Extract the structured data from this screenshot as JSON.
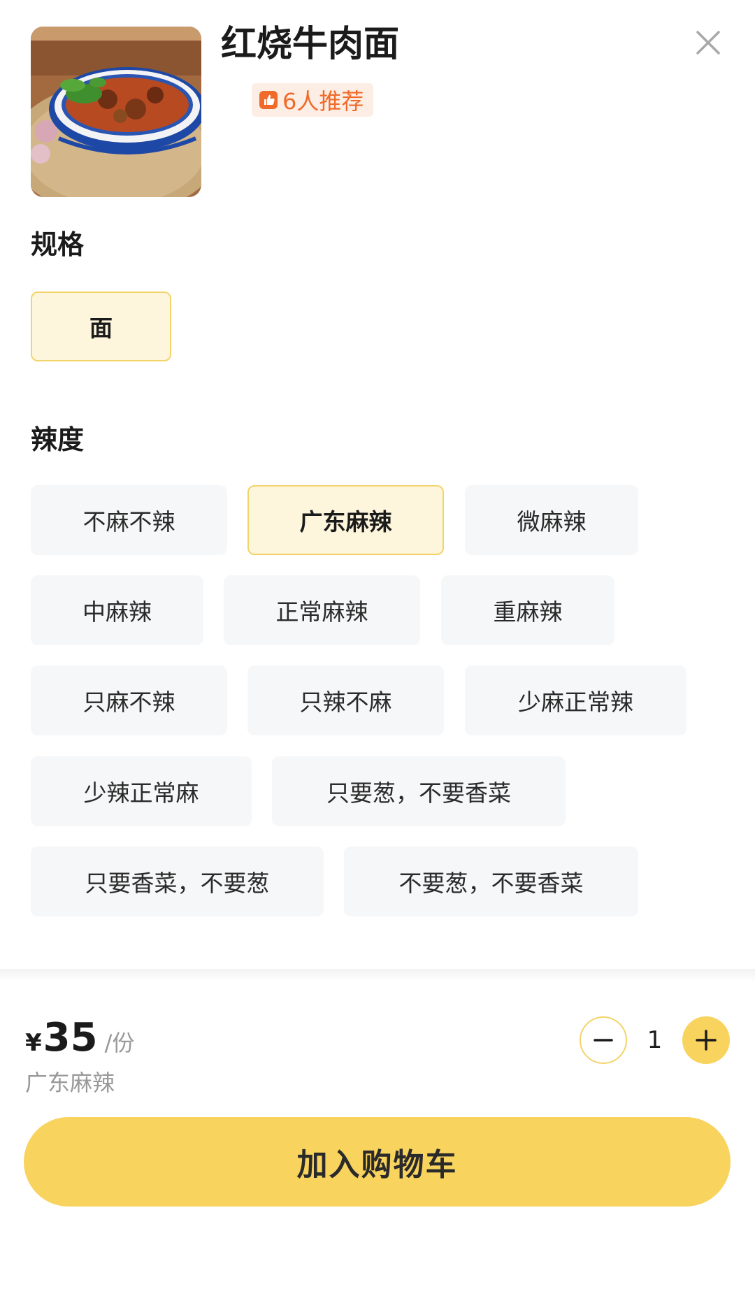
{
  "dish": {
    "title": "红烧牛肉面",
    "image_icon": "beef-noodle-bowl-photo",
    "recommend": {
      "icon": "thumbs-up-icon",
      "text": "6人推荐",
      "color": "#f06a2a"
    }
  },
  "close": {
    "icon": "close-icon"
  },
  "spec": {
    "title": "规格",
    "options": [
      {
        "label": "面",
        "selected": true
      }
    ]
  },
  "spiciness": {
    "title": "辣度",
    "options": [
      {
        "label": "不麻不辣",
        "selected": false
      },
      {
        "label": "广东麻辣",
        "selected": true
      },
      {
        "label": "微麻辣",
        "selected": false
      },
      {
        "label": "中麻辣",
        "selected": false
      },
      {
        "label": "正常麻辣",
        "selected": false
      },
      {
        "label": "重麻辣",
        "selected": false
      },
      {
        "label": "只麻不辣",
        "selected": false
      },
      {
        "label": "只辣不麻",
        "selected": false
      },
      {
        "label": "少麻正常辣",
        "selected": false
      },
      {
        "label": "少辣正常麻",
        "selected": false
      },
      {
        "label": "只要葱，不要香菜",
        "selected": false
      },
      {
        "label": "只要香菜，不要葱",
        "selected": false
      },
      {
        "label": "不要葱，不要香菜",
        "selected": false
      }
    ]
  },
  "footer": {
    "currency": "¥",
    "price": "35",
    "unit": "/份",
    "selected_summary": "广东麻辣",
    "quantity": "1",
    "minus_icon": "minus-icon",
    "plus_icon": "plus-icon",
    "add_to_cart_label": "加入购物车"
  },
  "colors": {
    "accent": "#f8d35d",
    "selected_bg": "#fdf6dc",
    "selected_border": "#f3d46a",
    "option_bg": "#f6f7f8"
  }
}
